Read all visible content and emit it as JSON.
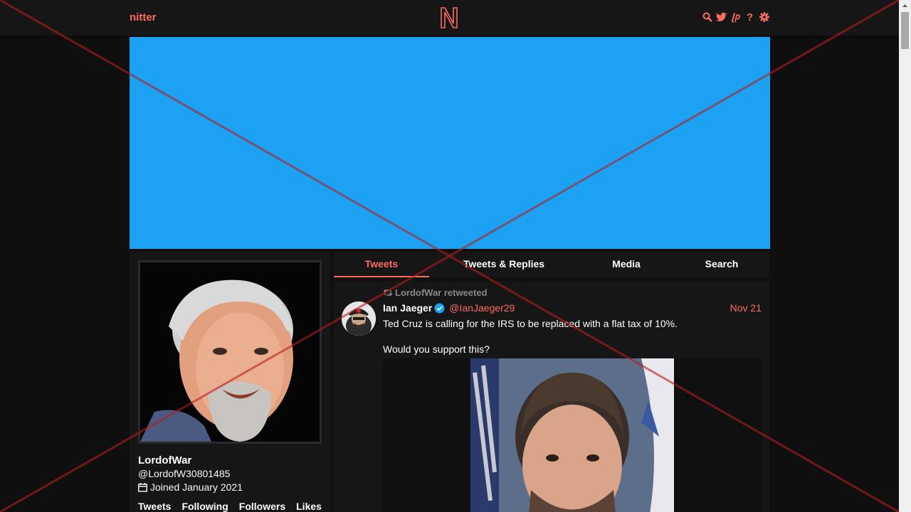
{
  "nav": {
    "brand": "nitter",
    "icons": [
      "search-icon",
      "twitter-icon",
      "liberapay-icon",
      "help-icon",
      "settings-icon"
    ],
    "help_glyph": "?"
  },
  "banner": {
    "color": "#1da1f2"
  },
  "profile": {
    "fullname": "LordofWar",
    "username": "@LordofW30801485",
    "joined": "Joined January 2021",
    "stats": [
      "Tweets",
      "Following",
      "Followers",
      "Likes"
    ]
  },
  "tabs": [
    {
      "label": "Tweets",
      "active": true
    },
    {
      "label": "Tweets & Replies",
      "active": false
    },
    {
      "label": "Media",
      "active": false
    },
    {
      "label": "Search",
      "active": false
    }
  ],
  "tweet": {
    "retweet_header": "LordofWar retweeted",
    "fullname": "Ian Jaeger",
    "username": "@IanJaeger29",
    "date": "Nov 21",
    "content": "Ted Cruz is calling for the IRS to be replaced with a flat tax of 10%.\n\nWould you support this?"
  },
  "colors": {
    "accent": "#ff6c60",
    "background": "#0f0f0f",
    "panel": "#161616",
    "overlay_cross": "#b41e1e"
  }
}
